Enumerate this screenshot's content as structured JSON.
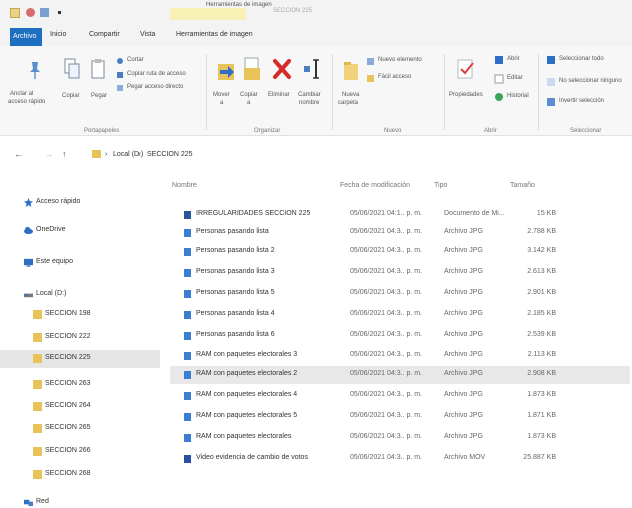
{
  "titlebar": {
    "title": "Herramientas de imagen",
    "subtitle": "SECCION 225",
    "quick_access_icons": [
      "properties-icon",
      "undo-icon",
      "folder-icon",
      "customize-icon"
    ]
  },
  "ribbon_tabs": [
    "Archivo",
    "Inicio",
    "Compartir",
    "Vista",
    "Herramientas de imagen"
  ],
  "ribbon": {
    "portapapeles": {
      "group_label": "Portapapeles",
      "anclar": "Anclar al",
      "anclar2": "acceso rápido",
      "copiar": "Copiar",
      "pegar": "Pegar",
      "cortar": "Cortar",
      "copiar_ruta": "Copiar ruta de acceso",
      "pegar_acceso": "Pegar acceso directo"
    },
    "organizar": {
      "group_label": "Organizar",
      "mover": "Mover",
      "mover2": "a",
      "copiar": "Copiar",
      "copiar2": "a",
      "eliminar": "Eliminar",
      "cambiar": "Cambiar",
      "cambiar2": "nombre"
    },
    "nuevo": {
      "group_label": "Nuevo",
      "nueva_carpeta": "Nueva",
      "nueva_carpeta2": "carpeta",
      "nuevo_elemento": "Nuevo elemento",
      "facil_acceso": "Fácil acceso"
    },
    "abrir": {
      "group_label": "Abrir",
      "propiedades": "Propiedades",
      "abrir": "Abrir",
      "editar": "Editar",
      "historial": "Historial"
    },
    "seleccionar": {
      "group_label": "Seleccionar",
      "seleccionar_todo": "Seleccionar todo",
      "no_seleccionar": "No seleccionar ninguno",
      "invertir": "Invertir selección"
    }
  },
  "address": {
    "back": "←",
    "forward": "→",
    "up": "↑",
    "path": [
      "Local (D:)",
      "SECCION 225"
    ],
    "separator": "›"
  },
  "nav_pane": [
    {
      "label": "Acceso rápido",
      "icon": "star-icon"
    },
    {
      "label": "OneDrive",
      "icon": "cloud-icon"
    },
    {
      "label": "Este equipo",
      "icon": "computer-icon"
    },
    {
      "label": "Local (D:)",
      "icon": "drive-icon"
    },
    {
      "label": "SECCION 198",
      "icon": "folder-icon"
    },
    {
      "label": "SECCION 222",
      "icon": "folder-icon"
    },
    {
      "label": "SECCION 225",
      "icon": "folder-icon",
      "selected": true
    },
    {
      "label": "SECCION 263",
      "icon": "folder-icon"
    },
    {
      "label": "SECCION 264",
      "icon": "folder-icon"
    },
    {
      "label": "SECCION 265",
      "icon": "folder-icon"
    },
    {
      "label": "SECCION 266",
      "icon": "folder-icon"
    },
    {
      "label": "SECCION 268",
      "icon": "folder-icon"
    },
    {
      "label": "Red",
      "icon": "network-icon"
    }
  ],
  "columns": {
    "name": "Nombre",
    "date": "Fecha de modificación",
    "type": "Tipo",
    "size": "Tamaño"
  },
  "files": [
    {
      "name": "IRREGULARIDADES SECCION 225",
      "date": "05/06/2021 04:1.. p. m.",
      "type": "Documento de Mi...",
      "size": "15 KB",
      "icon": "word-icon"
    },
    {
      "name": "Personas pasando lista",
      "date": "05/06/2021 04:3.. p. m.",
      "type": "Archivo JPG",
      "size": "2.788 KB",
      "icon": "image-icon"
    },
    {
      "name": "Personas pasando lista 2",
      "date": "05/06/2021 04:3.. p. m.",
      "type": "Archivo JPG",
      "size": "3.142 KB",
      "icon": "image-icon"
    },
    {
      "name": "Personas pasando lista 3",
      "date": "05/06/2021 04:3.. p. m.",
      "type": "Archivo JPG",
      "size": "2.613 KB",
      "icon": "image-icon"
    },
    {
      "name": "Personas pasando lista 5",
      "date": "05/06/2021 04:3.. p. m.",
      "type": "Archivo JPG",
      "size": "2.901 KB",
      "icon": "image-icon"
    },
    {
      "name": "Personas pasando lista 4",
      "date": "05/06/2021 04:3.. p. m.",
      "type": "Archivo JPG",
      "size": "2.185 KB",
      "icon": "image-icon"
    },
    {
      "name": "Personas pasando lista 6",
      "date": "05/06/2021 04:3.. p. m.",
      "type": "Archivo JPG",
      "size": "2.539 KB",
      "icon": "image-icon"
    },
    {
      "name": "RAM con paquetes electorales 3",
      "date": "05/06/2021 04:3.. p. m.",
      "type": "Archivo JPG",
      "size": "2.113 KB",
      "icon": "image-icon"
    },
    {
      "name": "RAM con paquetes electorales 2",
      "date": "05/06/2021 04:3.. p. m.",
      "type": "Archivo JPG",
      "size": "2.908 KB",
      "icon": "image-icon",
      "selected": true
    },
    {
      "name": "RAM con paquetes electorales 4",
      "date": "05/06/2021 04:3.. p. m.",
      "type": "Archivo JPG",
      "size": "1.873 KB",
      "icon": "image-icon"
    },
    {
      "name": "RAM con paquetes electorales 5",
      "date": "05/06/2021 04:3.. p. m.",
      "type": "Archivo JPG",
      "size": "1.871 KB",
      "icon": "image-icon"
    },
    {
      "name": "RAM con paquetes electorales",
      "date": "05/06/2021 04:3.. p. m.",
      "type": "Archivo JPG",
      "size": "1.873 KB",
      "icon": "image-icon"
    },
    {
      "name": "Video evidencia de cambio de votos",
      "date": "05/06/2021 04:3.. p. m.",
      "type": "Archivo MOV",
      "size": "25.887 KB",
      "icon": "video-icon"
    }
  ],
  "colors": {
    "accent": "#1e6fc0",
    "folder": "#e8c35a",
    "selected_row": "#e8e8e8",
    "delete_red": "#d62b2b"
  }
}
